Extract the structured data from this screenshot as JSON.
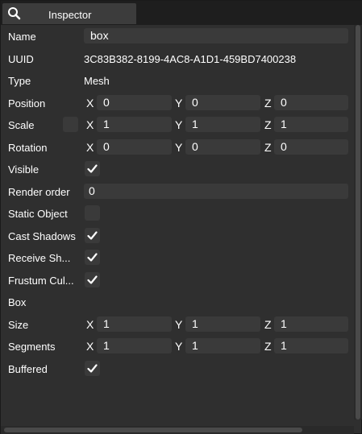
{
  "tab": {
    "title": "Inspector",
    "icon": "search-icon"
  },
  "name": {
    "label": "Name",
    "value": "box"
  },
  "uuid": {
    "label": "UUID",
    "value": "3C83B382-8199-4AC8-A1D1-459BD7400238"
  },
  "type": {
    "label": "Type",
    "value": "Mesh"
  },
  "position": {
    "label": "Position",
    "x": "0",
    "y": "0",
    "z": "0"
  },
  "scale": {
    "label": "Scale",
    "x": "1",
    "y": "1",
    "z": "1",
    "locked": false
  },
  "rotation": {
    "label": "Rotation",
    "x": "0",
    "y": "0",
    "z": "0"
  },
  "visible": {
    "label": "Visible",
    "checked": true
  },
  "render_order": {
    "label": "Render order",
    "value": "0"
  },
  "static_object": {
    "label": "Static Object",
    "checked": false
  },
  "cast_shadows": {
    "label": "Cast Shadows",
    "checked": true
  },
  "receive_shadows": {
    "label": "Receive Sh...",
    "checked": true
  },
  "frustum_culled": {
    "label": "Frustum Cul...",
    "checked": true
  },
  "box_section": {
    "label": "Box"
  },
  "size": {
    "label": "Size",
    "x": "1",
    "y": "1",
    "z": "1"
  },
  "segments": {
    "label": "Segments",
    "x": "1",
    "y": "1",
    "z": "1"
  },
  "buffered": {
    "label": "Buffered",
    "checked": true
  },
  "axes": {
    "x": "X",
    "y": "Y",
    "z": "Z"
  },
  "colors": {
    "panel": "#2f2f2f",
    "field": "#3a3a3a",
    "text": "#ffffff"
  }
}
